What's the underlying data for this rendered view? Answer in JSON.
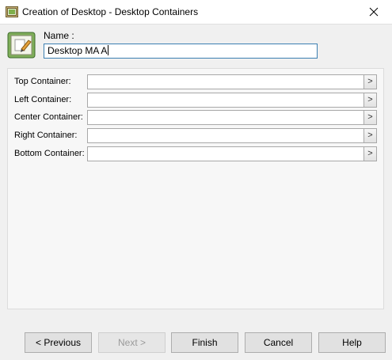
{
  "window": {
    "title": "Creation of Desktop - Desktop Containers",
    "app_icon": "desktop-app-icon",
    "close_icon": "close-icon"
  },
  "header": {
    "wizard_icon": "edit-desktop-icon",
    "name_label": "Name :",
    "name_value": "Desktop MA A"
  },
  "containers": [
    {
      "label": "Top Container:",
      "value": "",
      "browse": ">"
    },
    {
      "label": "Left Container:",
      "value": "",
      "browse": ">"
    },
    {
      "label": "Center Container:",
      "value": "",
      "browse": ">"
    },
    {
      "label": "Right Container:",
      "value": "",
      "browse": ">"
    },
    {
      "label": "Bottom Container:",
      "value": "",
      "browse": ">"
    }
  ],
  "buttons": {
    "previous": "< Previous",
    "next": "Next >",
    "finish": "Finish",
    "cancel": "Cancel",
    "help": "Help"
  }
}
